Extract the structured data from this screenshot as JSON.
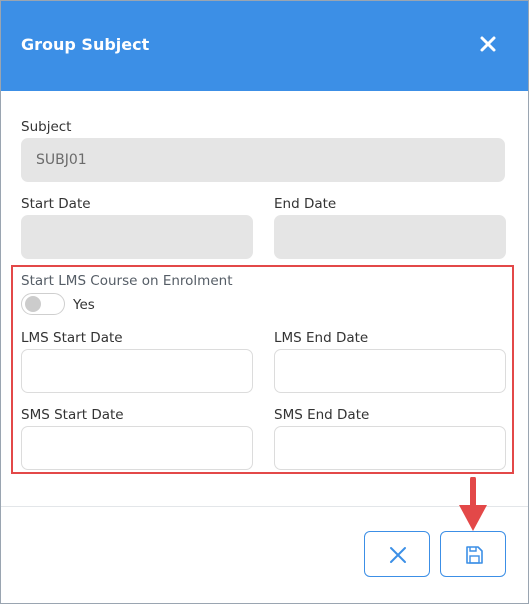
{
  "dialog": {
    "title": "Group Subject"
  },
  "fields": {
    "subject_label": "Subject",
    "subject_value": "SUBJ01",
    "start_date_label": "Start Date",
    "end_date_label": "End Date",
    "lms_toggle_label": "Start LMS Course on Enrolment",
    "lms_toggle_text": "Yes",
    "lms_start_label": "LMS Start Date",
    "lms_end_label": "LMS End Date",
    "sms_start_label": "SMS Start Date",
    "sms_end_label": "SMS End Date"
  },
  "icons": {
    "close": "close-icon",
    "cancel": "x-icon",
    "save": "floppy-disk-icon",
    "annotation": "red-arrow-down"
  },
  "colors": {
    "header": "#3c8fe6",
    "highlight": "#e34848",
    "button_border": "#3c8fe6"
  }
}
